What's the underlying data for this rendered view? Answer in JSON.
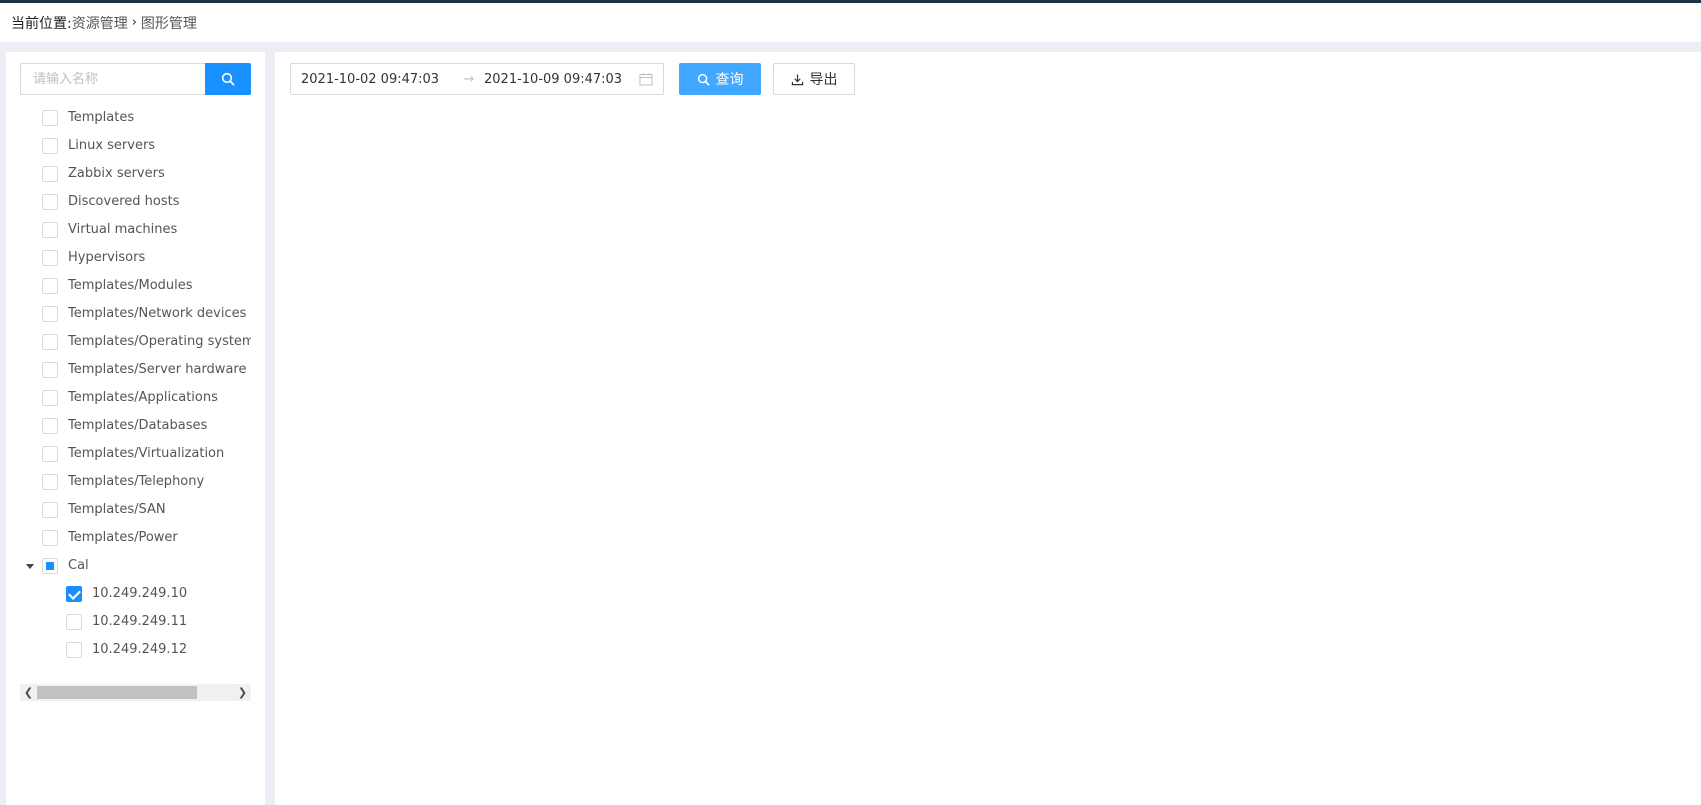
{
  "breadcrumb": {
    "prefix": "当前位置:",
    "items": [
      "资源管理",
      "图形管理"
    ],
    "separator": "›"
  },
  "sidebar": {
    "search_placeholder": "请输入名称",
    "search_value": "",
    "tree": [
      {
        "label": "Templates",
        "level": 0,
        "checked": "unchecked"
      },
      {
        "label": "Linux servers",
        "level": 0,
        "checked": "unchecked"
      },
      {
        "label": "Zabbix servers",
        "level": 0,
        "checked": "unchecked"
      },
      {
        "label": "Discovered hosts",
        "level": 0,
        "checked": "unchecked"
      },
      {
        "label": "Virtual machines",
        "level": 0,
        "checked": "unchecked"
      },
      {
        "label": "Hypervisors",
        "level": 0,
        "checked": "unchecked"
      },
      {
        "label": "Templates/Modules",
        "level": 0,
        "checked": "unchecked"
      },
      {
        "label": "Templates/Network devices",
        "level": 0,
        "checked": "unchecked"
      },
      {
        "label": "Templates/Operating systems",
        "level": 0,
        "checked": "unchecked"
      },
      {
        "label": "Templates/Server hardware",
        "level": 0,
        "checked": "unchecked"
      },
      {
        "label": "Templates/Applications",
        "level": 0,
        "checked": "unchecked"
      },
      {
        "label": "Templates/Databases",
        "level": 0,
        "checked": "unchecked"
      },
      {
        "label": "Templates/Virtualization",
        "level": 0,
        "checked": "unchecked"
      },
      {
        "label": "Templates/Telephony",
        "level": 0,
        "checked": "unchecked"
      },
      {
        "label": "Templates/SAN",
        "level": 0,
        "checked": "unchecked"
      },
      {
        "label": "Templates/Power",
        "level": 0,
        "checked": "unchecked"
      },
      {
        "label": "Cal",
        "level": 0,
        "checked": "indeterminate",
        "expanded": true
      },
      {
        "label": "10.249.249.10",
        "level": 1,
        "checked": "checked"
      },
      {
        "label": "10.249.249.11",
        "level": 1,
        "checked": "unchecked"
      },
      {
        "label": "10.249.249.12",
        "level": 1,
        "checked": "unchecked"
      }
    ]
  },
  "toolbar": {
    "range_start": "2021-10-02 09:47:03",
    "range_separator": "→",
    "range_end": "2021-10-09 09:47:03",
    "query_label": "查询",
    "export_label": "导出"
  },
  "colors": {
    "primary": "#1890ff",
    "query_button": "#40a9ff",
    "top_bar": "#1f3346",
    "page_background": "#ebeef2"
  }
}
